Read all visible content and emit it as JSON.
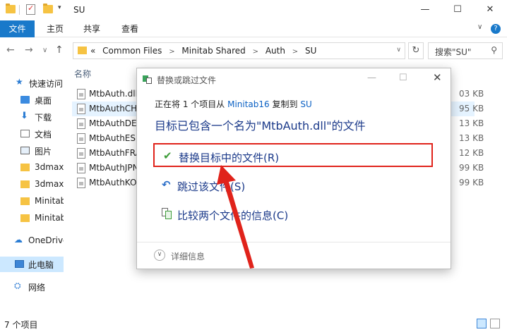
{
  "window": {
    "title": "SU",
    "minimize": "—",
    "maximize": "☐",
    "close": "✕"
  },
  "ribbon": {
    "tabs": [
      "文件",
      "主页",
      "共享",
      "查看"
    ],
    "help": "?"
  },
  "navigation": {
    "back": "←",
    "forward": "→",
    "dropdown": "∨",
    "up": "↑",
    "breadcrumb": [
      "«",
      "Common Files",
      ">",
      "Minitab Shared",
      ">",
      "Auth",
      ">",
      "SU"
    ],
    "refresh": "↻",
    "search_placeholder": "搜索\"SU\""
  },
  "sidebar": {
    "items": [
      {
        "label": "快速访问",
        "icon": "star-icon"
      },
      {
        "label": "桌面",
        "icon": "desktop-icon"
      },
      {
        "label": "下载",
        "icon": "download-icon"
      },
      {
        "label": "文档",
        "icon": "document-icon"
      },
      {
        "label": "图片",
        "icon": "picture-icon"
      },
      {
        "label": "3dmax",
        "icon": "folder-icon"
      },
      {
        "label": "3dmax",
        "icon": "folder-icon"
      },
      {
        "label": "Minitab",
        "icon": "folder-icon"
      },
      {
        "label": "Minitab",
        "icon": "folder-icon"
      },
      {
        "label": "OneDrive",
        "icon": "cloud-icon"
      },
      {
        "label": "此电脑",
        "icon": "pc-icon"
      },
      {
        "label": "网络",
        "icon": "network-icon"
      }
    ]
  },
  "files": {
    "column_name": "名称",
    "rows": [
      {
        "name": "MtbAuth.dll",
        "size": "03 KB"
      },
      {
        "name": "MtbAuthCHS",
        "size": "95 KB"
      },
      {
        "name": "MtbAuthDE",
        "size": "13 KB"
      },
      {
        "name": "MtbAuthESI",
        "size": "13 KB"
      },
      {
        "name": "MtbAuthFRA",
        "size": "12 KB"
      },
      {
        "name": "MtbAuthJPN",
        "size": "99 KB"
      },
      {
        "name": "MtbAuthKO",
        "size": "99 KB"
      }
    ]
  },
  "status": {
    "count": "7 个项目"
  },
  "dialog": {
    "title": "替换或跳过文件",
    "copy_prefix": "正在将 1 个项目从",
    "copy_source": "Minitab16",
    "copy_middle": "复制到",
    "copy_dest": "SU",
    "heading": "目标已包含一个名为\"MtbAuth.dll\"的文件",
    "options": [
      {
        "label": "替换目标中的文件(R)",
        "icon": "check-icon"
      },
      {
        "label": "跳过该文件(S)",
        "icon": "skip-icon"
      },
      {
        "label": "比较两个文件的信息(C)",
        "icon": "compare-icon"
      }
    ],
    "details": "详细信息",
    "minimize": "—",
    "maximize": "☐",
    "close": "✕"
  },
  "colors": {
    "accent": "#1979ca",
    "highlight_border": "#e0231b",
    "annotation_arrow": "#e0231b",
    "option_text": "#1b3a8a"
  }
}
